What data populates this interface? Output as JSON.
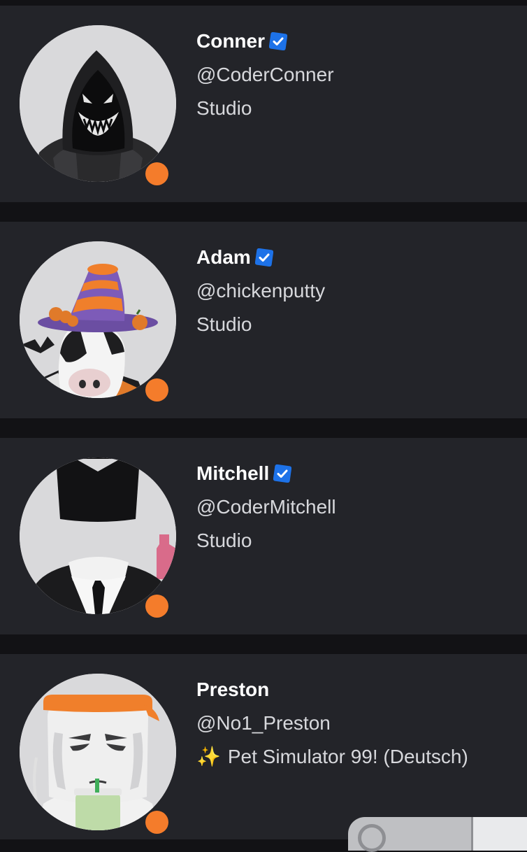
{
  "creators": [
    {
      "display_name": "Conner",
      "username": "@CoderConner",
      "subtitle": "Studio",
      "verified": true,
      "status": "online",
      "avatar_icon": "hooded-figure-avatar"
    },
    {
      "display_name": "Adam",
      "username": "@chickenputty",
      "subtitle": "Studio",
      "verified": true,
      "status": "online",
      "avatar_icon": "witch-hat-cow-avatar"
    },
    {
      "display_name": "Mitchell",
      "username": "@CoderMitchell",
      "subtitle": "Studio",
      "verified": true,
      "status": "online",
      "avatar_icon": "headless-suit-avatar"
    },
    {
      "display_name": "Preston",
      "username": "@No1_Preston",
      "subtitle_icon": "✨",
      "subtitle": "Pet Simulator 99! (Deutsch)",
      "verified": false,
      "status": "online",
      "avatar_icon": "headband-avatar"
    }
  ],
  "colors": {
    "background": "#121215",
    "card": "#232429",
    "status_online": "#f47c2b",
    "verified_badge": "#1d72e8"
  }
}
